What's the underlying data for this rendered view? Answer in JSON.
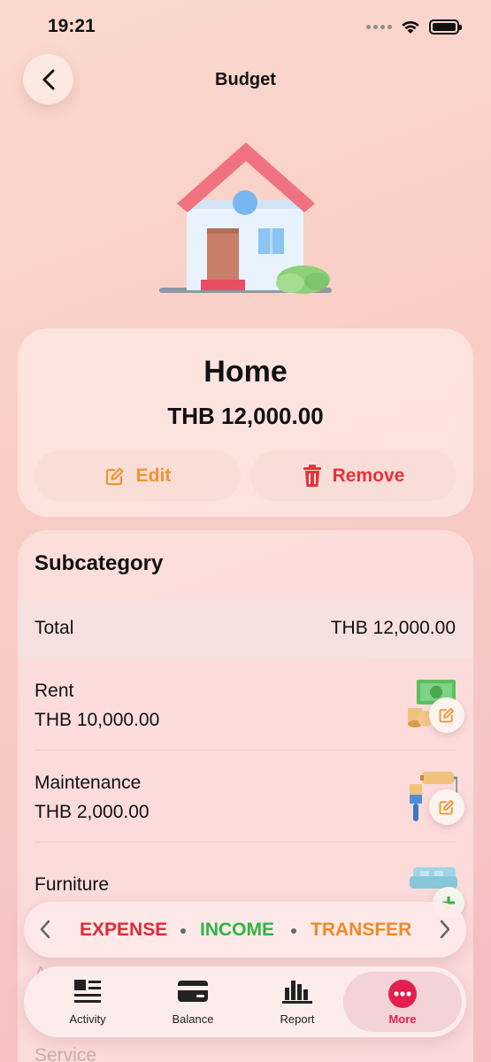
{
  "status": {
    "time": "19:21"
  },
  "header": {
    "title": "Budget"
  },
  "category": {
    "name": "Home",
    "amount": "THB 12,000.00",
    "edit_label": "Edit",
    "remove_label": "Remove"
  },
  "subcategory": {
    "title": "Subcategory",
    "total_label": "Total",
    "total_value": "THB 12,000.00",
    "items": [
      {
        "name": "Rent",
        "amount": "THB 10,000.00",
        "icon": "money-icon"
      },
      {
        "name": "Maintenance",
        "amount": "THB 2,000.00",
        "icon": "paint-tools-icon"
      },
      {
        "name": "Furniture",
        "amount": "",
        "icon": "sofa-icon"
      }
    ],
    "faded_items": [
      "A",
      "Service"
    ]
  },
  "type_switcher": {
    "expense": "EXPENSE",
    "income": "INCOME",
    "transfer": "TRANSFER"
  },
  "tabs": [
    {
      "label": "Activity",
      "icon": "activity-icon"
    },
    {
      "label": "Balance",
      "icon": "wallet-card-icon"
    },
    {
      "label": "Report",
      "icon": "bar-chart-icon"
    },
    {
      "label": "More",
      "icon": "more-icon",
      "active": true
    }
  ],
  "colors": {
    "expense": "#e02a3a",
    "income": "#2fb447",
    "transfer": "#f0892a",
    "edit": "#f0932f",
    "remove": "#e8313a",
    "active_tab": "#e21f4f"
  }
}
